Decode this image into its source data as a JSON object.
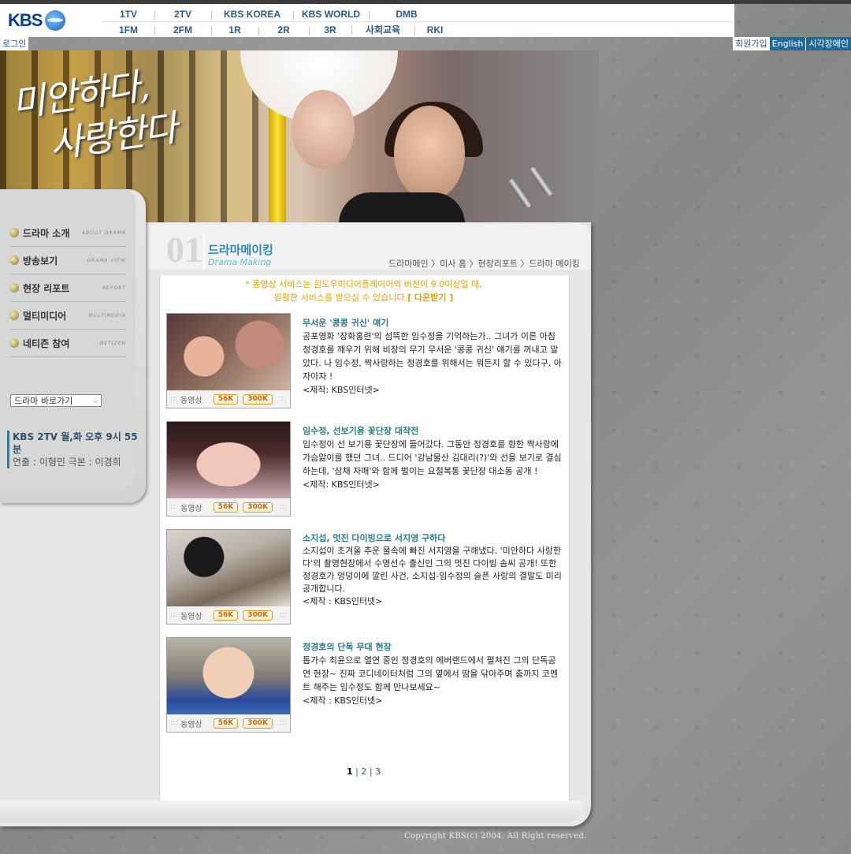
{
  "nav": {
    "logo_text": "KBS",
    "row1": [
      "1TV",
      "2TV",
      "KBS KOREA",
      "KBS WORLD",
      "DMB"
    ],
    "row2": [
      "1FM",
      "2FM",
      "1R",
      "2R",
      "3R",
      "사회교육",
      "RKI"
    ]
  },
  "util": {
    "login": "로그인",
    "join": "회원가입",
    "english": "English",
    "blind": "시각장애인"
  },
  "banner": {
    "title_line1": "미안하다,",
    "title_line2": "사랑한다"
  },
  "sidebar": {
    "items": [
      {
        "label": "드라마 소개",
        "en": "ABOUT DRAMA"
      },
      {
        "label": "방송보기",
        "en": "DRAMA VIEW"
      },
      {
        "label": "현장 리포트",
        "en": "REPORT"
      },
      {
        "label": "멀티미디어",
        "en": "MULTIMEDIA"
      },
      {
        "label": "네티즌 참여",
        "en": "NETIZEN"
      }
    ],
    "select_value": "드라마 바로가기",
    "air_line1": "KBS 2TV 월,화 오후 9시 55분",
    "air_line2": "연출 : 이형민  극본 : 이경희"
  },
  "section": {
    "number": "01",
    "title_ko": "드라마메이킹",
    "title_en": "Drama Making",
    "breadcrumb": "드라마메인 〉미사 홈 〉현장리포트 〉드라마 메이킹"
  },
  "notice": {
    "line1": "* 동영상 서비스는 윈도우미디어플레이어의 버전이 9.0이상일 때,",
    "line2": "원활한 서비스를 받으실 수 있습니다.",
    "download": "[ 다운받기 ]"
  },
  "video_bar": {
    "label": "동영상",
    "low": "56K",
    "high": "300K"
  },
  "articles": [
    {
      "title": "무서운 '콩콩 귀신' 얘기",
      "body": "공포영화 '장화홍련'의 섬뜩한 임수정을 기억하는가.. 그녀가 이른 아침 정경호를 깨우기 위해 비장의 무기 무서운 '콩콩 귀신' 얘기를 꺼내고 말았다. 나 임수정, 짝사랑하는 정경호를 위해서는 뭐든지 할 수 있다구, 아자아자 !",
      "credit": "<제작: KBS인터넷>"
    },
    {
      "title": "임수정, 선보기용 꽃단장 대작전",
      "body": "임수정이 선 보기용 꽃단장에 들어갔다. 그동안 정경호를 향한 짝사랑에 가슴앓이를 했던 그녀.. 드디어 '강남물산 김대리(?)'와 선을 보기로 결심하는데, '삼채 자매'와 함께 벌이는 요절복통 꽃단장 대소동 공개 !",
      "credit": "<제작: KBS인터넷>"
    },
    {
      "title": "소지섭, 멋진 다이빙으로 서지영 구하다",
      "body": "소지섭이 초겨울 추운 물속에 빠진 서지영을 구해냈다. '미안하다 사랑한다'의 촬영현장에서 수영선수 출신인 그의 멋진 다이빙 솜씨 공개! 또한 정경호가 엉덩이에 깔린 사건, 소지섭-임수정의 슬픈 사랑의 결말도 미리 공개합니다.",
      "credit": "<제작 : KBS인터넷>"
    },
    {
      "title": "정경호의 단독 무대 현장",
      "body": "톱가수 최윤으로 열연 중인  정경호의 에버랜드에서 펼쳐진 그의 단독공연 현장~ 진짜 코디네이터처럼 그의 옆에서 땀을 닦아주며 춤까지 코멘트 해주는 임수정도 함께 만나보세요~",
      "credit": "<제작 : KBS인터넷>"
    }
  ],
  "pager": {
    "p1": "1",
    "sep": "|",
    "p2": "2",
    "p3": "3"
  },
  "copyright": "Copyright KBS(c) 2004. All Right reserved."
}
